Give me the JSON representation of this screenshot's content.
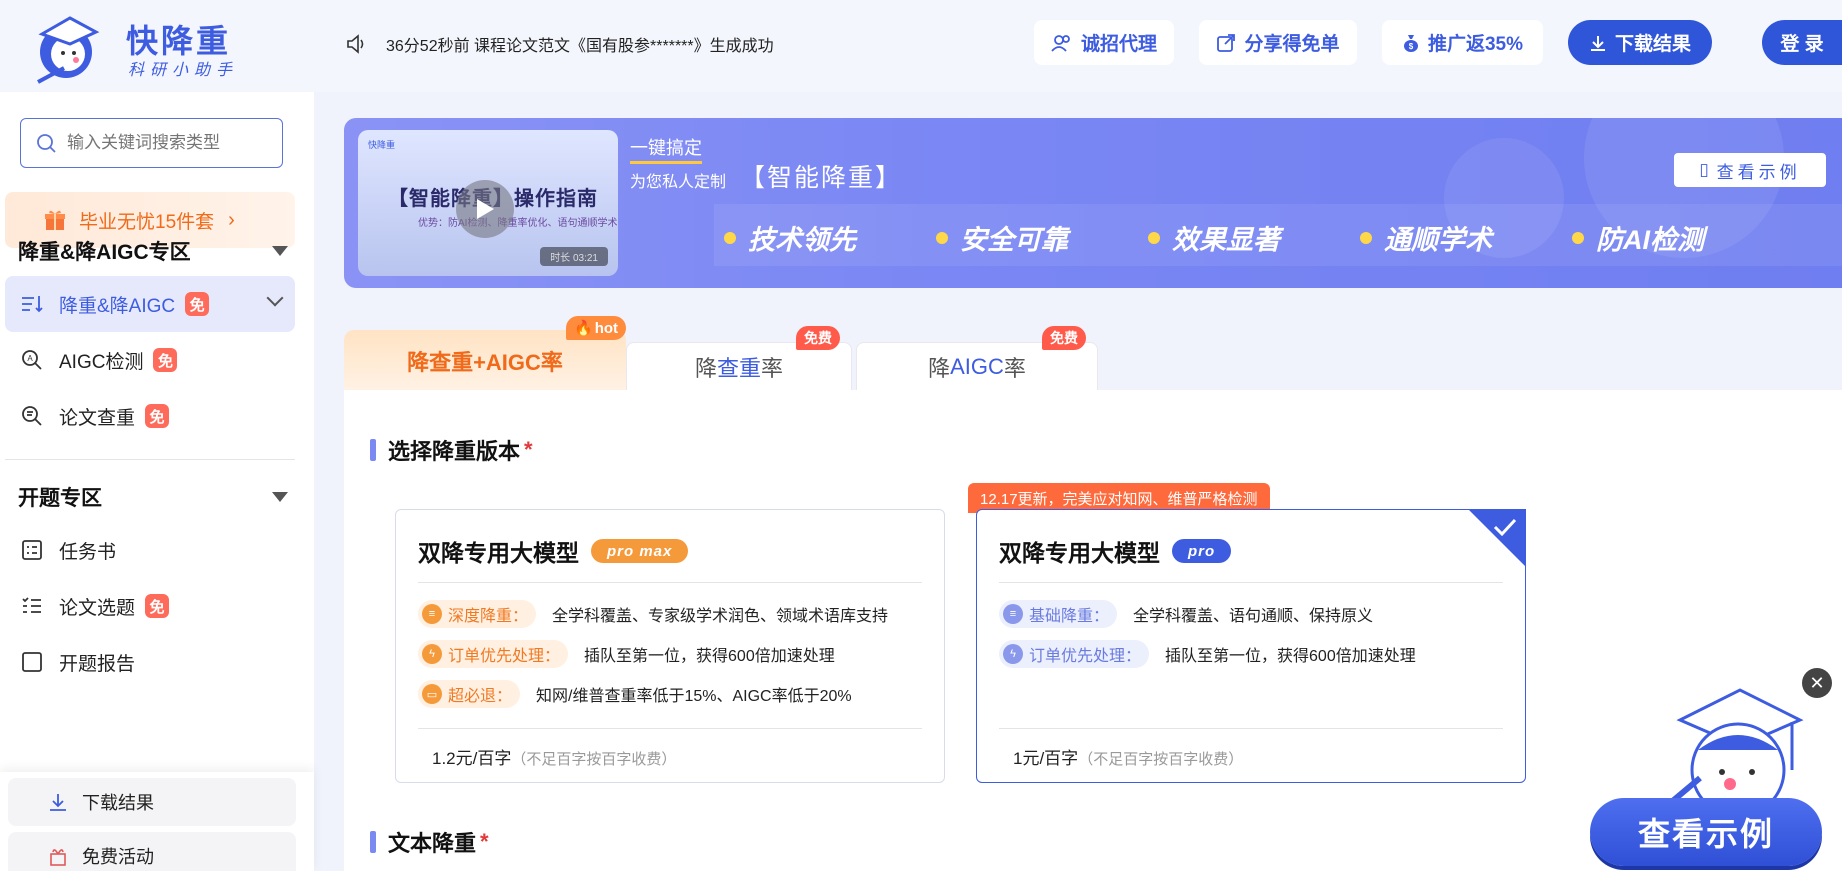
{
  "header": {
    "logo_title": "快降重",
    "logo_sub": "科研小助手",
    "notice": "36分52秒前 课程论文范文《国有股参*******》生成成功",
    "buttons": {
      "agent": "诚招代理",
      "share": "分享得免单",
      "promo": "推广返35%",
      "download": "下载结果",
      "login": "登 录"
    }
  },
  "sidebar": {
    "search_placeholder": "输入关键词搜索类型",
    "promo": "毕业无忧15件套",
    "section1": "降重&降AIGC专区",
    "items1": [
      {
        "label": "降重&降AIGC",
        "badge": "免"
      },
      {
        "label": "AIGC检测",
        "badge": "免"
      },
      {
        "label": "论文查重",
        "badge": "免"
      }
    ],
    "section2": "开题专区",
    "items2": [
      {
        "label": "任务书"
      },
      {
        "label": "论文选题",
        "badge": "免"
      },
      {
        "label": "开题报告"
      }
    ],
    "bottom": {
      "download": "下载结果",
      "free": "免费活动"
    }
  },
  "banner": {
    "video_logo": "快降重",
    "video_title": "【智能降重】操作指南",
    "video_sub": "优势：防AI检测、降重率优化、语句通顺学术",
    "video_duration": "时长 03:21",
    "kicker": "一键搞定",
    "sub": "为您私人定制",
    "title": "【智能降重】",
    "example_btn": "查看示例",
    "features": [
      "技术领先",
      "安全可靠",
      "效果显著",
      "通顺学术",
      "防AI检测"
    ]
  },
  "tabs": [
    {
      "label": "降查重+AIGC率",
      "tag": "hot"
    },
    {
      "label_a": "降",
      "label_b": "查重",
      "label_c": "率",
      "tag": "免费"
    },
    {
      "label_a": "降",
      "label_b": "AIGC",
      "label_c": "率",
      "tag": "免费"
    }
  ],
  "content": {
    "section_version": "选择降重版本",
    "section_text": "文本降重",
    "update_note": "12.17更新，完美应对知网、维普严格检测",
    "cards": [
      {
        "title": "双降专用大模型",
        "chip": "pro max",
        "rows": [
          {
            "pill": "深度降重：",
            "text": "全学科覆盖、专家级学术润色、领域术语库支持"
          },
          {
            "pill": "订单优先处理：",
            "text": "插队至第一位，获得600倍加速处理"
          },
          {
            "pill": "超必退：",
            "text": "知网/维普查重率低于15%、AIGC率低于20%"
          }
        ],
        "price": "1.2元/百字",
        "price_note": "（不足百字按百字收费）"
      },
      {
        "title": "双降专用大模型",
        "chip": "pro",
        "rows": [
          {
            "pill": "基础降重：",
            "text": "全学科覆盖、语句通顺、保持原义"
          },
          {
            "pill": "订单优先处理：",
            "text": "插队至第一位，获得600倍加速处理"
          }
        ],
        "price": "1元/百字",
        "price_note": "（不足百字按百字收费）"
      }
    ]
  },
  "float": {
    "close": "✕",
    "button": "查看示例"
  },
  "colors": {
    "brand": "#3d5ce0",
    "accent_orange": "#f06a1a",
    "free_badge": "#ff6b5b"
  }
}
